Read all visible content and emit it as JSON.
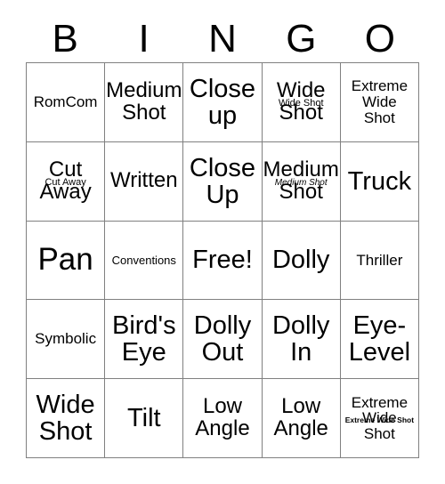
{
  "header": {
    "letters": [
      "B",
      "I",
      "N",
      "G",
      "O"
    ]
  },
  "grid": {
    "rows": [
      [
        {
          "text": "RomCom",
          "size": "fs-sm"
        },
        {
          "text": "Medium\nShot",
          "size": "fs-md"
        },
        {
          "text": "Close\nup",
          "size": "fs-lg"
        },
        {
          "text": "Wide\nShot",
          "size": "fs-md",
          "overlay": "Wide Shot",
          "overlay_style": "ov-1"
        },
        {
          "text": "Extreme\nWide\nShot",
          "size": "fs-sm"
        }
      ],
      [
        {
          "text": "Cut\nAway",
          "size": "fs-md",
          "overlay": "Cut Away",
          "overlay_style": "ov-2"
        },
        {
          "text": "Written",
          "size": "fs-md"
        },
        {
          "text": "Close\nUp",
          "size": "fs-lg"
        },
        {
          "text": "Medium\nShot",
          "size": "fs-md",
          "overlay": "Medium Shot",
          "overlay_style": "ov-3"
        },
        {
          "text": "Truck",
          "size": "fs-lg"
        }
      ],
      [
        {
          "text": "Pan",
          "size": "fs-xl"
        },
        {
          "text": "Conventions",
          "size": "fs-xs"
        },
        {
          "text": "Free!",
          "size": "fs-lg"
        },
        {
          "text": "Dolly",
          "size": "fs-lg"
        },
        {
          "text": "Thriller",
          "size": "fs-sm"
        }
      ],
      [
        {
          "text": "Symbolic",
          "size": "fs-sm"
        },
        {
          "text": "Bird's\nEye",
          "size": "fs-lg"
        },
        {
          "text": "Dolly\nOut",
          "size": "fs-lg"
        },
        {
          "text": "Dolly\nIn",
          "size": "fs-lg"
        },
        {
          "text": "Eye-\nLevel",
          "size": "fs-lg"
        }
      ],
      [
        {
          "text": "Wide\nShot",
          "size": "fs-lg"
        },
        {
          "text": "Tilt",
          "size": "fs-lg"
        },
        {
          "text": "Low\nAngle",
          "size": "fs-md"
        },
        {
          "text": "Low\nAngle",
          "size": "fs-md"
        },
        {
          "text": "Extreme\nWide\nShot",
          "size": "fs-sm",
          "overlay": "Extreme Wide Shot",
          "overlay_style": "ov-4"
        }
      ]
    ]
  },
  "colors": {
    "grid_line": "#808080",
    "text": "#000000",
    "background": "#ffffff"
  }
}
